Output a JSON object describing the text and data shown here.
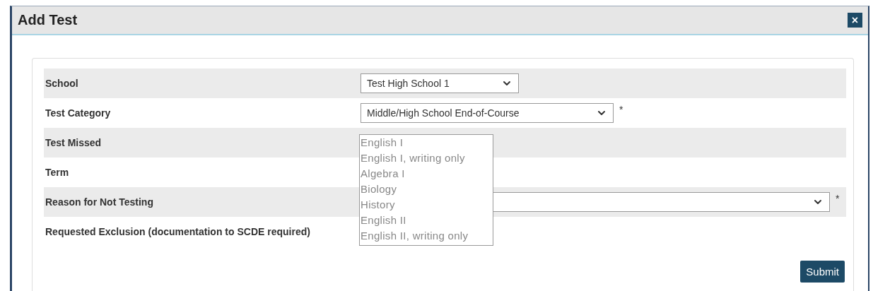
{
  "dialog": {
    "title": "Add Test",
    "close_label": "×"
  },
  "rows": [
    {
      "label": "School",
      "kind": "select",
      "value": "Test High School 1"
    },
    {
      "label": "Test Category",
      "kind": "select",
      "value": "Middle/High School End-of-Course",
      "required_mark": "*"
    },
    {
      "label": "Test Missed",
      "kind": "listbox",
      "options": [
        "English I",
        "English I, writing only",
        "Algebra I",
        "Biology",
        "History",
        "English II",
        "English II, writing only"
      ]
    },
    {
      "label": "Term",
      "kind": "none"
    },
    {
      "label": "Reason for Not Testing",
      "kind": "select",
      "required_mark": "*"
    },
    {
      "label": "Requested Exclusion (documentation to SCDE required)",
      "kind": "none"
    }
  ],
  "submit": "Submit"
}
